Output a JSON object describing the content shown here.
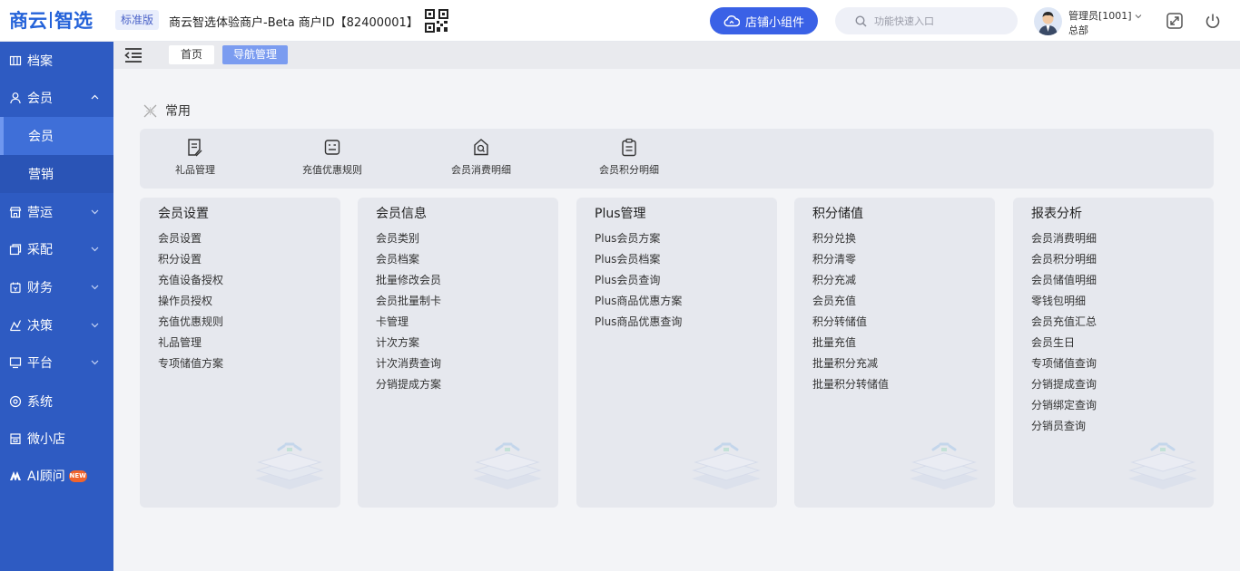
{
  "header": {
    "logo_part1": "商云",
    "logo_part2": "智选",
    "edition_badge": "标准版",
    "merchant_info": "商云智选体验商户-Beta  商户ID【82400001】",
    "widget_button": "店铺小组件",
    "search_placeholder": "功能快速入口",
    "user_name": "管理员[1001]",
    "user_org": "总部"
  },
  "sidebar": {
    "items": [
      {
        "label": "档案",
        "icon": "archive-icon"
      },
      {
        "label": "会员",
        "icon": "user-icon",
        "expanded": true
      },
      {
        "label": "会员",
        "sub": true,
        "active": true
      },
      {
        "label": "营销",
        "sub": true
      },
      {
        "label": "营运",
        "icon": "store-icon"
      },
      {
        "label": "采配",
        "icon": "purchase-icon"
      },
      {
        "label": "财务",
        "icon": "finance-icon"
      },
      {
        "label": "决策",
        "icon": "decision-icon"
      },
      {
        "label": "平台",
        "icon": "monitor-icon"
      },
      {
        "label": "系统",
        "icon": "system-icon"
      },
      {
        "label": "微小店",
        "icon": "shop-icon"
      },
      {
        "label": "AI顾问",
        "icon": "ai-icon",
        "badge": "NEW"
      }
    ]
  },
  "tabs": [
    {
      "label": "首页"
    },
    {
      "label": "导航管理",
      "active": true
    }
  ],
  "common": {
    "title": "常用",
    "items": [
      {
        "label": "礼品管理",
        "icon": "gift-doc-icon"
      },
      {
        "label": "充值优惠规则",
        "icon": "rule-icon"
      },
      {
        "label": "会员消费明细",
        "icon": "consume-icon"
      },
      {
        "label": "会员积分明细",
        "icon": "clipboard-icon"
      }
    ]
  },
  "cards": [
    {
      "title": "会员设置",
      "links": [
        "会员设置",
        "积分设置",
        "充值设备授权",
        "操作员授权",
        "充值优惠规则",
        "礼品管理",
        "专项储值方案"
      ]
    },
    {
      "title": "会员信息",
      "links": [
        "会员类别",
        "会员档案",
        "批量修改会员",
        "会员批量制卡",
        "卡管理",
        "计次方案",
        "计次消费查询",
        "分销提成方案"
      ]
    },
    {
      "title": "Plus管理",
      "links": [
        "Plus会员方案",
        "Plus会员档案",
        "Plus会员查询",
        "Plus商品优惠方案",
        "Plus商品优惠查询"
      ]
    },
    {
      "title": "积分储值",
      "links": [
        "积分兑换",
        "积分清零",
        "积分充减",
        "会员充值",
        "积分转储值",
        "批量充值",
        "批量积分充减",
        "批量积分转储值"
      ]
    },
    {
      "title": "报表分析",
      "links": [
        "会员消费明细",
        "会员积分明细",
        "会员储值明细",
        "零钱包明细",
        "会员充值汇总",
        "会员生日",
        "专项储值查询",
        "分销提成查询",
        "分销绑定查询",
        "分销员查询"
      ]
    }
  ],
  "colors": {
    "brand": "#2563d9",
    "sidebar_bg": "#2e5bc2",
    "accent_button": "#3a61e6",
    "active_tab": "#7b9cf0",
    "new_badge": "#f0642d"
  }
}
